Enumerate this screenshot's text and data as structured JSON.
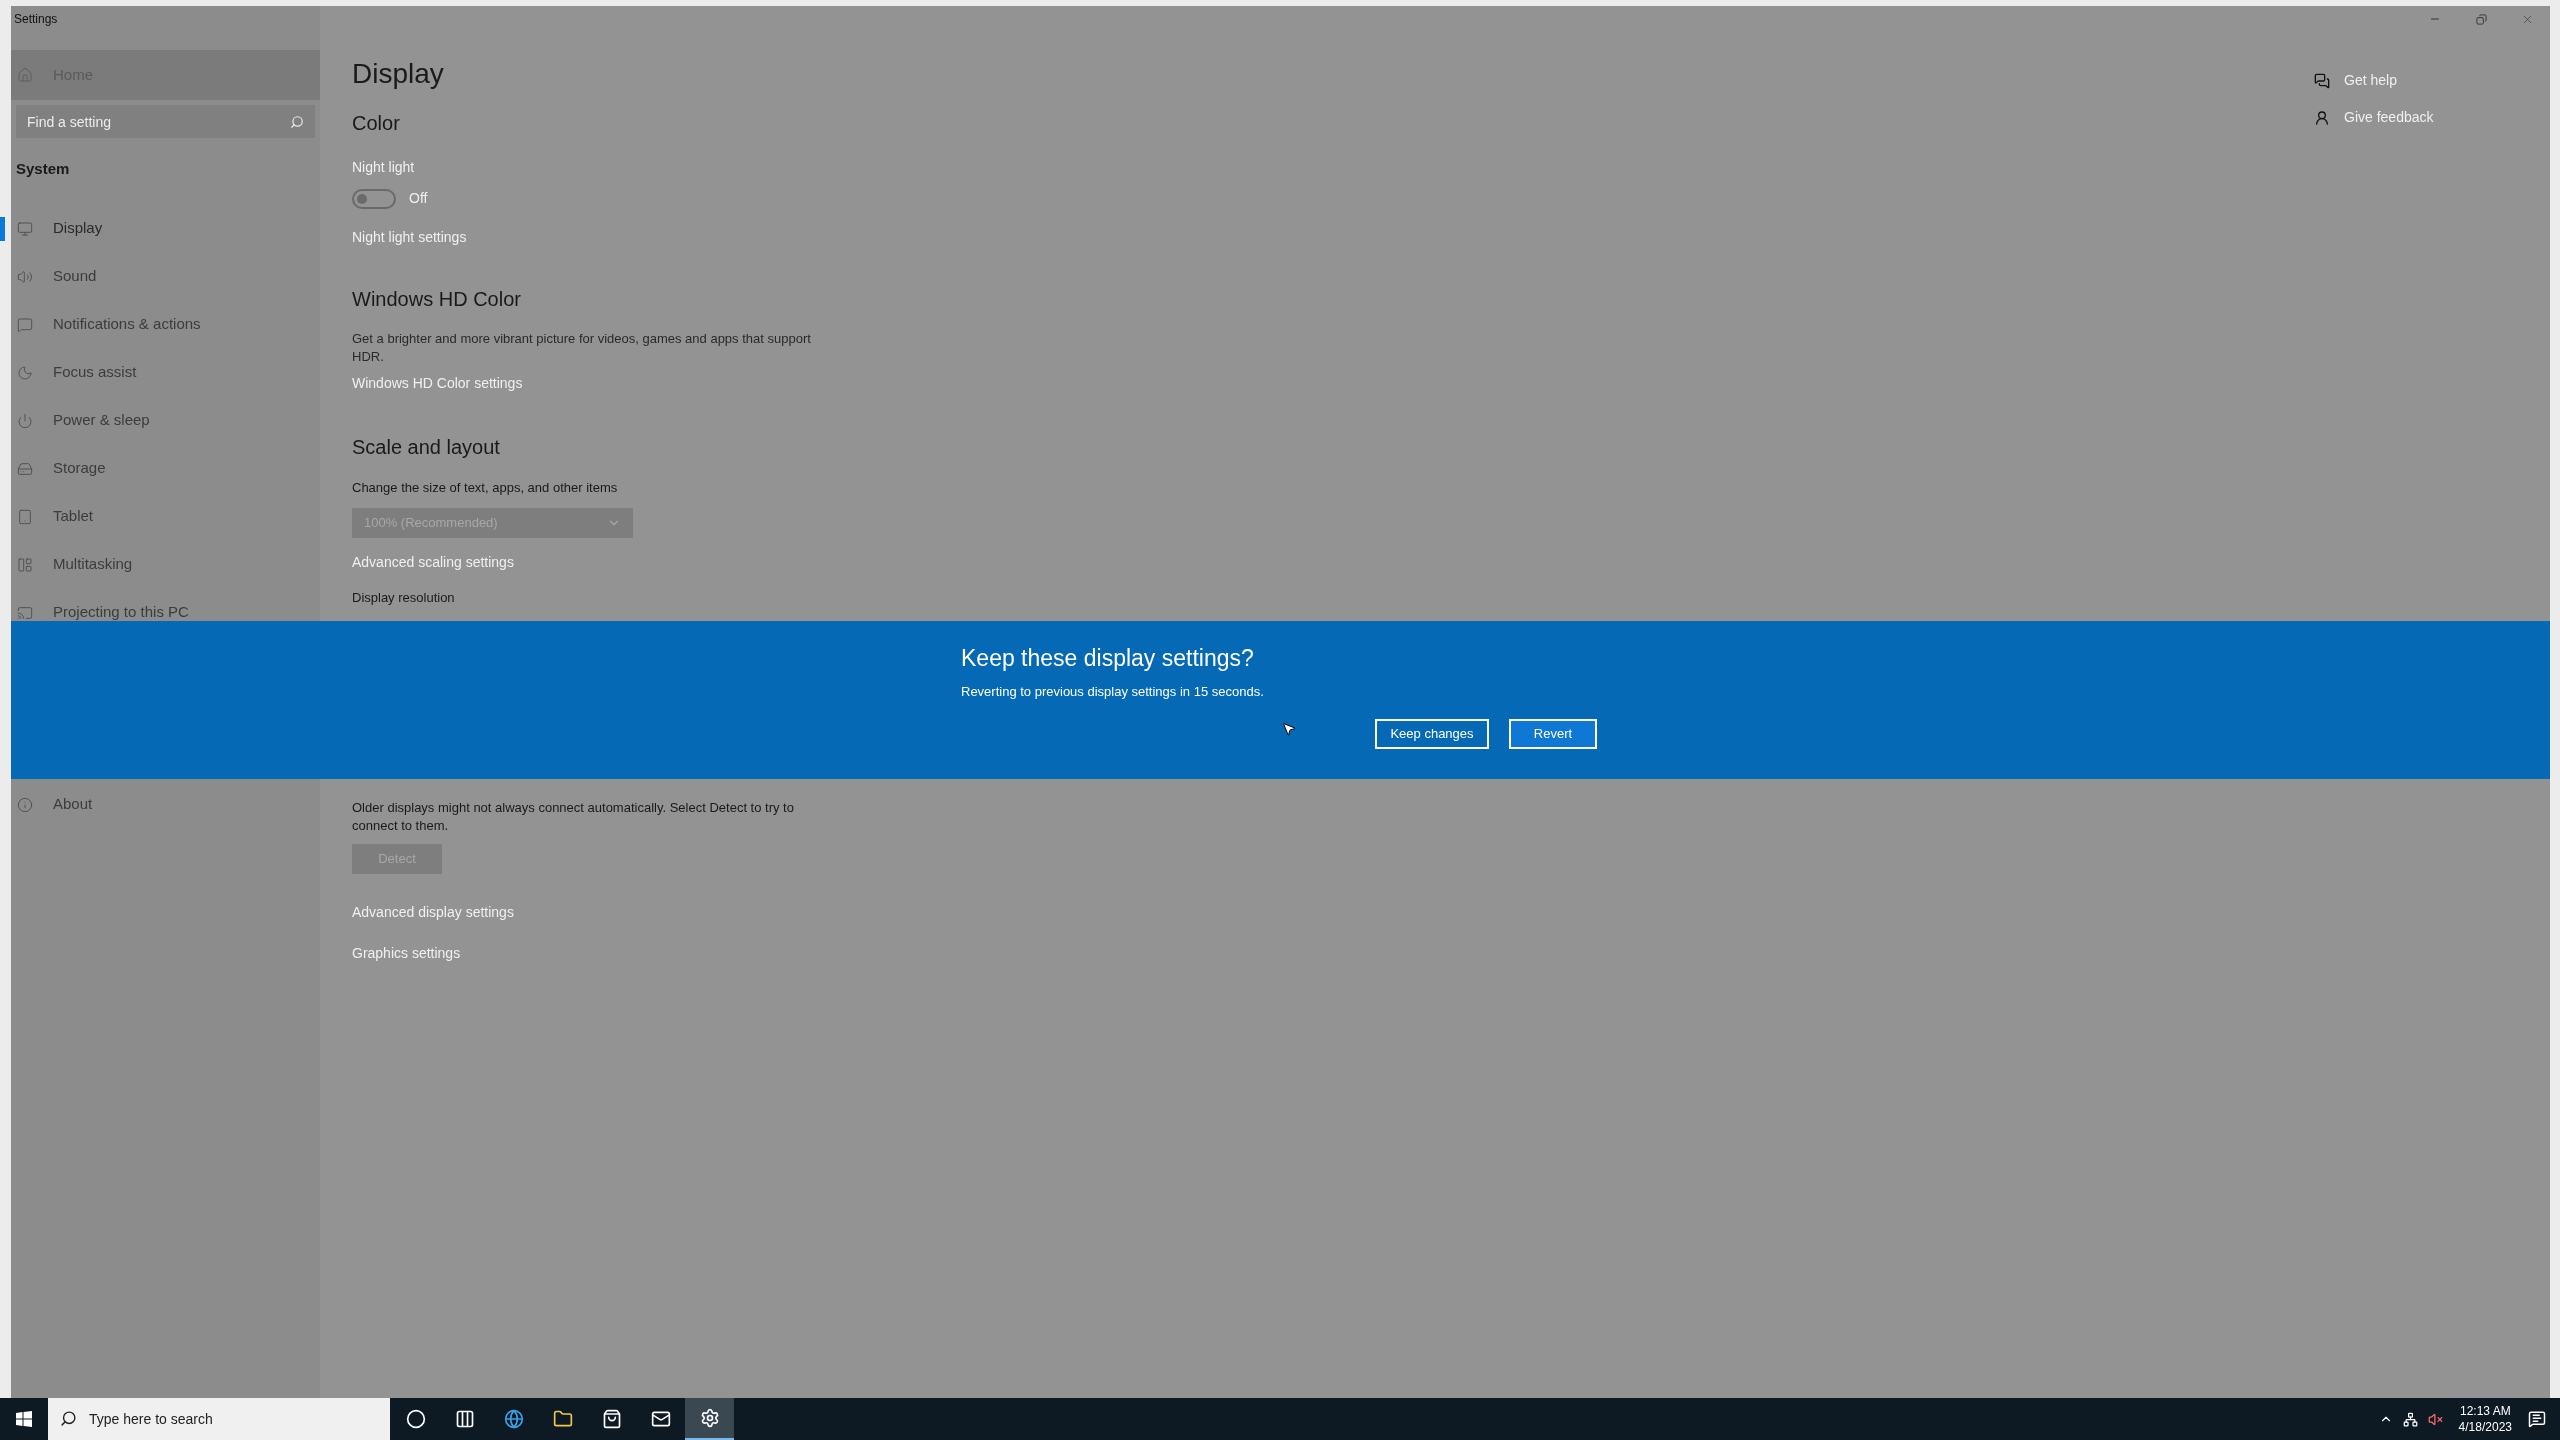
{
  "window": {
    "title": "Settings"
  },
  "sidebar": {
    "home": "Home",
    "search_placeholder": "Find a setting",
    "section": "System",
    "items": [
      {
        "label": "Display",
        "selected": true
      },
      {
        "label": "Sound",
        "selected": false
      },
      {
        "label": "Notifications & actions",
        "selected": false
      },
      {
        "label": "Focus assist",
        "selected": false
      },
      {
        "label": "Power & sleep",
        "selected": false
      },
      {
        "label": "Storage",
        "selected": false
      },
      {
        "label": "Tablet",
        "selected": false
      },
      {
        "label": "Multitasking",
        "selected": false
      },
      {
        "label": "Projecting to this PC",
        "selected": false
      }
    ],
    "bottom_items": [
      {
        "label": "About",
        "selected": false
      }
    ]
  },
  "content": {
    "title": "Display",
    "color_heading": "Color",
    "night_light": {
      "label": "Night light",
      "on": false,
      "state_text": "Off"
    },
    "night_light_link": "Night light settings",
    "hd_heading": "Windows HD Color",
    "hd_description": "Get a brighter and more vibrant picture for videos, games and apps that support HDR.",
    "hd_link": "Windows HD Color settings",
    "scale_heading": "Scale and layout",
    "scale_label": "Change the size of text, apps, and other items",
    "scale_value": "100% (Recommended)",
    "scale_link": "Advanced scaling settings",
    "resolution_label": "Display resolution",
    "detect_text": "Older displays might not always connect automatically. Select Detect to try to connect to them.",
    "detect_button": "Detect",
    "links": [
      "Advanced display settings",
      "Graphics settings"
    ]
  },
  "related": [
    "Get help",
    "Give feedback"
  ],
  "banner": {
    "title": "Keep these display settings?",
    "message": "Reverting to previous display settings in 15 seconds.",
    "buttons": [
      "Keep changes",
      "Revert"
    ]
  },
  "taskbar": {
    "search_placeholder": "Type here to search",
    "apps": [
      {
        "selected": false
      },
      {
        "selected": false
      },
      {
        "selected": false
      },
      {
        "selected": false
      },
      {
        "selected": false
      },
      {
        "selected": false
      },
      {
        "selected": true
      }
    ],
    "time": "12:13 AM",
    "date": "4/18/2023"
  }
}
